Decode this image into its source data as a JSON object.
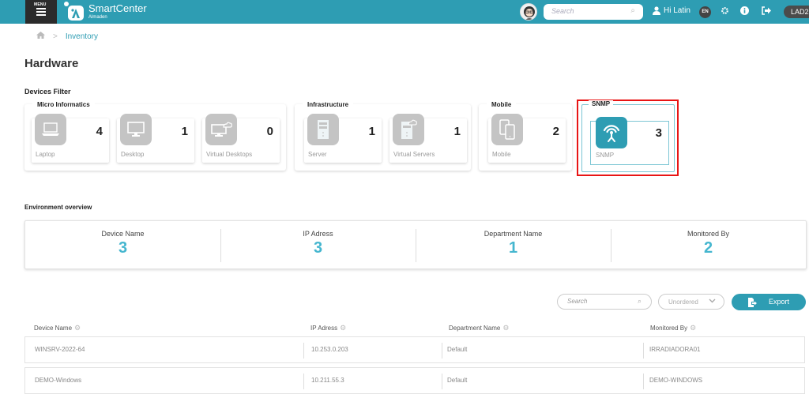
{
  "header": {
    "menu_mini_label": "MENU",
    "brand_name": "SmartCenter",
    "brand_sub": "Almaden",
    "search_placeholder": "Search",
    "greeting": "Hi Latin",
    "language": "EN",
    "tenant": "LAD2",
    "icons": [
      "menu-icon",
      "logo-icon",
      "avatar",
      "search-icon",
      "user-icon",
      "gear-icon",
      "info-icon",
      "logout-icon"
    ]
  },
  "breadcrumb": {
    "home_icon": "home-icon",
    "separator": ">",
    "current": "Inventory"
  },
  "page": {
    "title": "Hardware",
    "filter_title": "Devices Filter",
    "overview_title": "Environment overview"
  },
  "filters": {
    "micro": {
      "label": "Micro Informatics",
      "cards": [
        {
          "label": "Laptop",
          "count": "4",
          "icon": "laptop-icon"
        },
        {
          "label": "Desktop",
          "count": "1",
          "icon": "desktop-icon"
        },
        {
          "label": "Virtual Desktops",
          "count": "0",
          "icon": "virtual-desktop-icon"
        }
      ]
    },
    "infra": {
      "label": "Infrastructure",
      "cards": [
        {
          "label": "Server",
          "count": "1",
          "icon": "server-icon"
        },
        {
          "label": "Virtual Servers",
          "count": "1",
          "icon": "virtual-server-icon"
        }
      ]
    },
    "mobile": {
      "label": "Mobile",
      "cards": [
        {
          "label": "Mobile",
          "count": "2",
          "icon": "mobile-icon"
        }
      ]
    },
    "snmp": {
      "label": "SNMP",
      "selected": true,
      "cards": [
        {
          "label": "SNMP",
          "count": "3",
          "icon": "antenna-icon"
        }
      ]
    }
  },
  "overview": [
    {
      "label": "Device Name",
      "value": "3"
    },
    {
      "label": "IP Adress",
      "value": "3"
    },
    {
      "label": "Department Name",
      "value": "1"
    },
    {
      "label": "Monitored By",
      "value": "2"
    }
  ],
  "table_controls": {
    "search_placeholder": "Search",
    "sort_value": "Unordered",
    "export_label": "Export"
  },
  "table": {
    "columns": [
      "Device Name",
      "IP Adress",
      "Department Name",
      "Monitored By"
    ],
    "rows": [
      [
        "WINSRV-2022-64",
        "10.253.0.203",
        "Default",
        "IRRADIADORA01"
      ],
      [
        "DEMO-Windows",
        "10.211.55.3",
        "Default",
        "DEMO-WINDOWS"
      ]
    ]
  },
  "colors": {
    "brand": "#2e9db3",
    "highlight": "#e81515",
    "value": "#45b6cf"
  }
}
